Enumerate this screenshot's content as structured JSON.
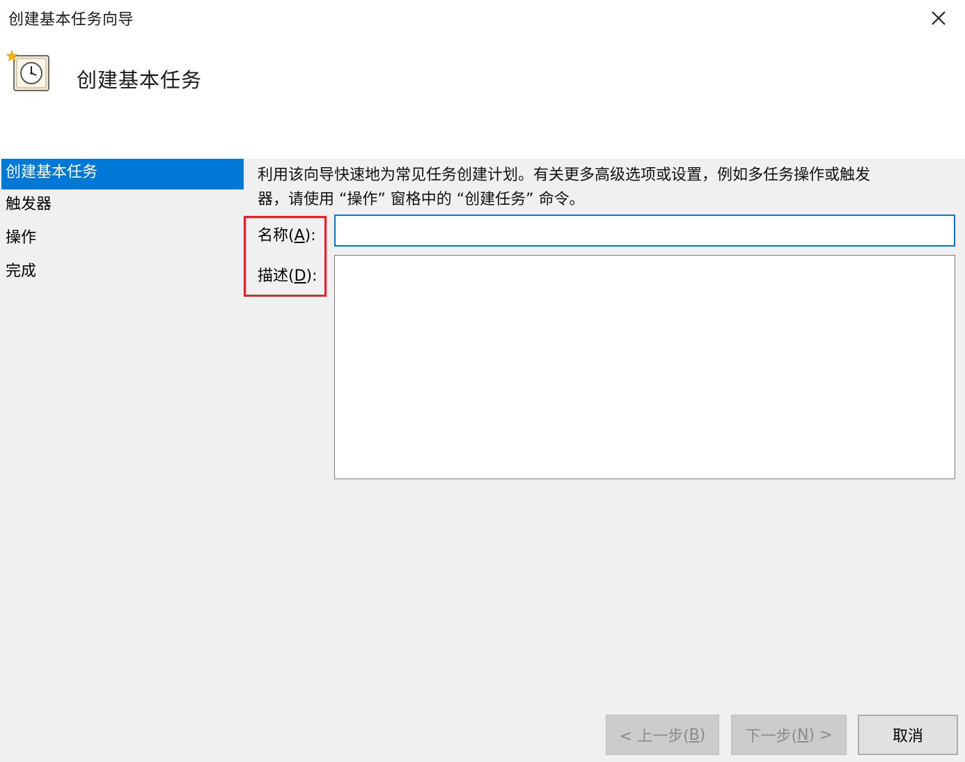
{
  "window": {
    "title": "创建基本任务向导",
    "close_icon": "close-icon"
  },
  "header": {
    "title": "创建基本任务",
    "icon": "task-scheduler-clock-icon"
  },
  "sidebar": {
    "items": [
      {
        "label": "创建基本任务",
        "active": true
      },
      {
        "label": "触发器",
        "active": false
      },
      {
        "label": "操作",
        "active": false
      },
      {
        "label": "完成",
        "active": false
      }
    ]
  },
  "main": {
    "intro_line1": "利用该向导快速地为常见任务创建计划。有关更多高级选项或设置，例如多任务操作或触发",
    "intro_line2": "器，请使用 “操作” 窗格中的 “创建任务” 命令。",
    "name_label_prefix": "名称(",
    "name_label_key": "A",
    "name_label_suffix": "):",
    "name_value": "",
    "desc_label_prefix": "描述(",
    "desc_label_key": "D",
    "desc_label_suffix": "):",
    "desc_value": ""
  },
  "footer": {
    "back_prefix": "< 上一步(",
    "back_key": "B",
    "back_suffix": ")",
    "next_prefix": "下一步(",
    "next_key": "N",
    "next_suffix": ") >",
    "cancel_label": "取消"
  },
  "colors": {
    "accent": "#0078d7",
    "highlight_border": "#e8202a",
    "background": "#f0f0f0"
  }
}
